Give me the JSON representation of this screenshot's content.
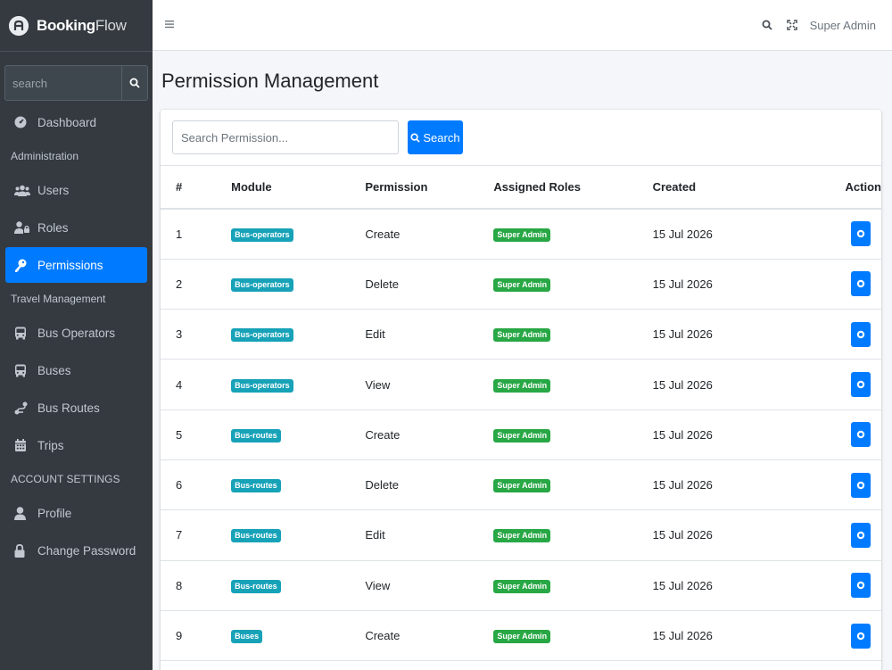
{
  "brand": {
    "name_bold": "Booking",
    "name_light": "Flow"
  },
  "sidebar": {
    "search_placeholder": "search",
    "items": [
      {
        "type": "item",
        "label": "Dashboard",
        "icon": "dashboard-icon"
      },
      {
        "type": "header",
        "label": "Administration"
      },
      {
        "type": "item",
        "label": "Users",
        "icon": "users-icon"
      },
      {
        "type": "item",
        "label": "Roles",
        "icon": "user-lock-icon"
      },
      {
        "type": "item",
        "label": "Permissions",
        "icon": "key-icon",
        "active": true
      },
      {
        "type": "header",
        "label": "Travel Management"
      },
      {
        "type": "item",
        "label": "Bus Operators",
        "icon": "bus-icon"
      },
      {
        "type": "item",
        "label": "Buses",
        "icon": "bus-icon"
      },
      {
        "type": "item",
        "label": "Bus Routes",
        "icon": "route-icon"
      },
      {
        "type": "item",
        "label": "Trips",
        "icon": "calendar-icon"
      },
      {
        "type": "header",
        "label": "ACCOUNT SETTINGS"
      },
      {
        "type": "item",
        "label": "Profile",
        "icon": "user-icon"
      },
      {
        "type": "item",
        "label": "Change Password",
        "icon": "lock-icon"
      }
    ]
  },
  "topbar": {
    "user_name": "Super Admin"
  },
  "page": {
    "title": "Permission Management",
    "search_placeholder": "Search Permission...",
    "search_button": "Search"
  },
  "table": {
    "columns": [
      "#",
      "Module",
      "Permission",
      "Assigned Roles",
      "Created",
      "Action"
    ],
    "rows": [
      {
        "num": "1",
        "module": "Bus-operators",
        "permission": "Create",
        "role": "Super Admin",
        "created": "15 Jul 2026"
      },
      {
        "num": "2",
        "module": "Bus-operators",
        "permission": "Delete",
        "role": "Super Admin",
        "created": "15 Jul 2026"
      },
      {
        "num": "3",
        "module": "Bus-operators",
        "permission": "Edit",
        "role": "Super Admin",
        "created": "15 Jul 2026"
      },
      {
        "num": "4",
        "module": "Bus-operators",
        "permission": "View",
        "role": "Super Admin",
        "created": "15 Jul 2026"
      },
      {
        "num": "5",
        "module": "Bus-routes",
        "permission": "Create",
        "role": "Super Admin",
        "created": "15 Jul 2026"
      },
      {
        "num": "6",
        "module": "Bus-routes",
        "permission": "Delete",
        "role": "Super Admin",
        "created": "15 Jul 2026"
      },
      {
        "num": "7",
        "module": "Bus-routes",
        "permission": "Edit",
        "role": "Super Admin",
        "created": "15 Jul 2026"
      },
      {
        "num": "8",
        "module": "Bus-routes",
        "permission": "View",
        "role": "Super Admin",
        "created": "15 Jul 2026"
      },
      {
        "num": "9",
        "module": "Buses",
        "permission": "Create",
        "role": "Super Admin",
        "created": "15 Jul 2026"
      }
    ]
  },
  "colors": {
    "sidebar_bg": "#343a40",
    "primary": "#007bff",
    "module_badge": "#17a2b8",
    "role_badge": "#28a745"
  }
}
